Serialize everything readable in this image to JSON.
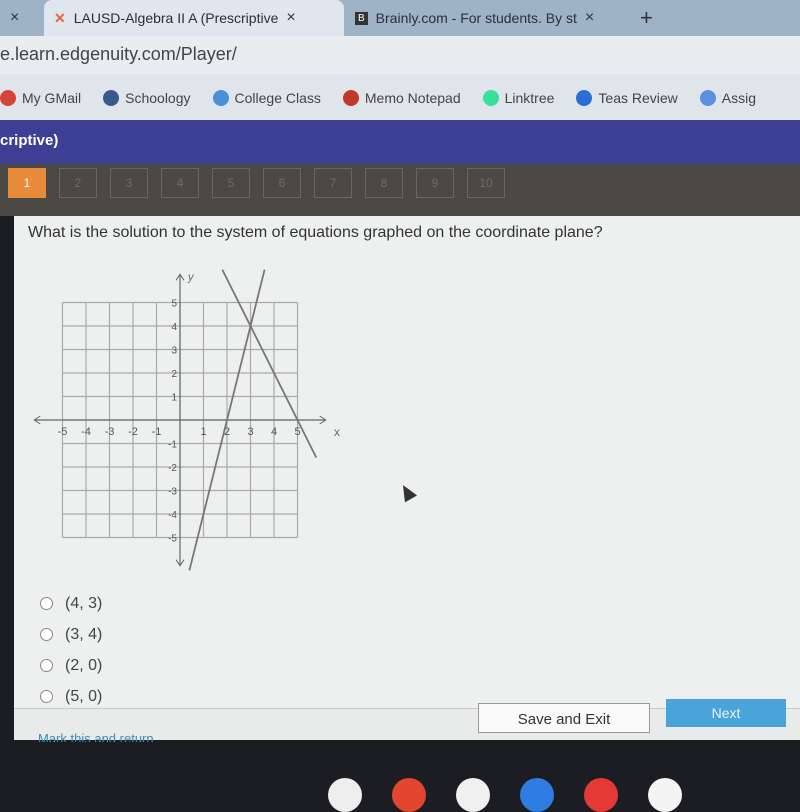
{
  "browser": {
    "tabs": [
      {
        "label": "LAUSD-Algebra II A (Prescriptive",
        "active": true
      },
      {
        "label": "Brainly.com - For students. By st",
        "active": false
      }
    ],
    "new_tab": "+",
    "close": "×",
    "url": "e.learn.edgenuity.com/Player/",
    "bookmarks": [
      {
        "label": "My GMail",
        "color": "#d44638"
      },
      {
        "label": "Schoology",
        "color": "#3a5a8c"
      },
      {
        "label": "College Class",
        "color": "#4a90d9"
      },
      {
        "label": "Memo Notepad",
        "color": "#c0392b"
      },
      {
        "label": "Linktree",
        "color": "#39e09b"
      },
      {
        "label": "Teas Review",
        "color": "#2b6fd6"
      },
      {
        "label": "Assig",
        "color": "#5b8fe0"
      }
    ]
  },
  "header": {
    "title": "criptive)"
  },
  "question_nav": {
    "items": [
      "1",
      "2",
      "3",
      "4",
      "5",
      "6",
      "7",
      "8",
      "9",
      "10"
    ],
    "current": "1",
    "accent": "#e88b3a"
  },
  "question": {
    "text": "What is the solution to the system of equations graphed on the coordinate plane?",
    "graph": {
      "x_label": "x",
      "y_label": "y",
      "x_ticks": [
        "-5",
        "-4",
        "-3",
        "-2",
        "-1",
        "1",
        "2",
        "3",
        "4",
        "5"
      ],
      "y_ticks": [
        "-5",
        "-4",
        "-3",
        "-2",
        "-1",
        "1",
        "2",
        "3",
        "4",
        "5"
      ],
      "xlim": [
        -5,
        5
      ],
      "ylim": [
        -5,
        5
      ],
      "lines": [
        {
          "points": [
            [
              2,
              0
            ],
            [
              3,
              4
            ]
          ]
        },
        {
          "points": [
            [
              3,
              4
            ],
            [
              5,
              0
            ]
          ]
        }
      ]
    },
    "answers": [
      "(4, 3)",
      "(3, 4)",
      "(2, 0)",
      "(5, 0)"
    ]
  },
  "footer": {
    "save_exit": "Save and Exit",
    "next": "Next",
    "mark_return": "Mark this and return"
  },
  "dock_colors": [
    "#eeeeee",
    "#e2462f",
    "#f0f0f0",
    "#2f7de1",
    "#e53935",
    "#f4f4f4"
  ]
}
